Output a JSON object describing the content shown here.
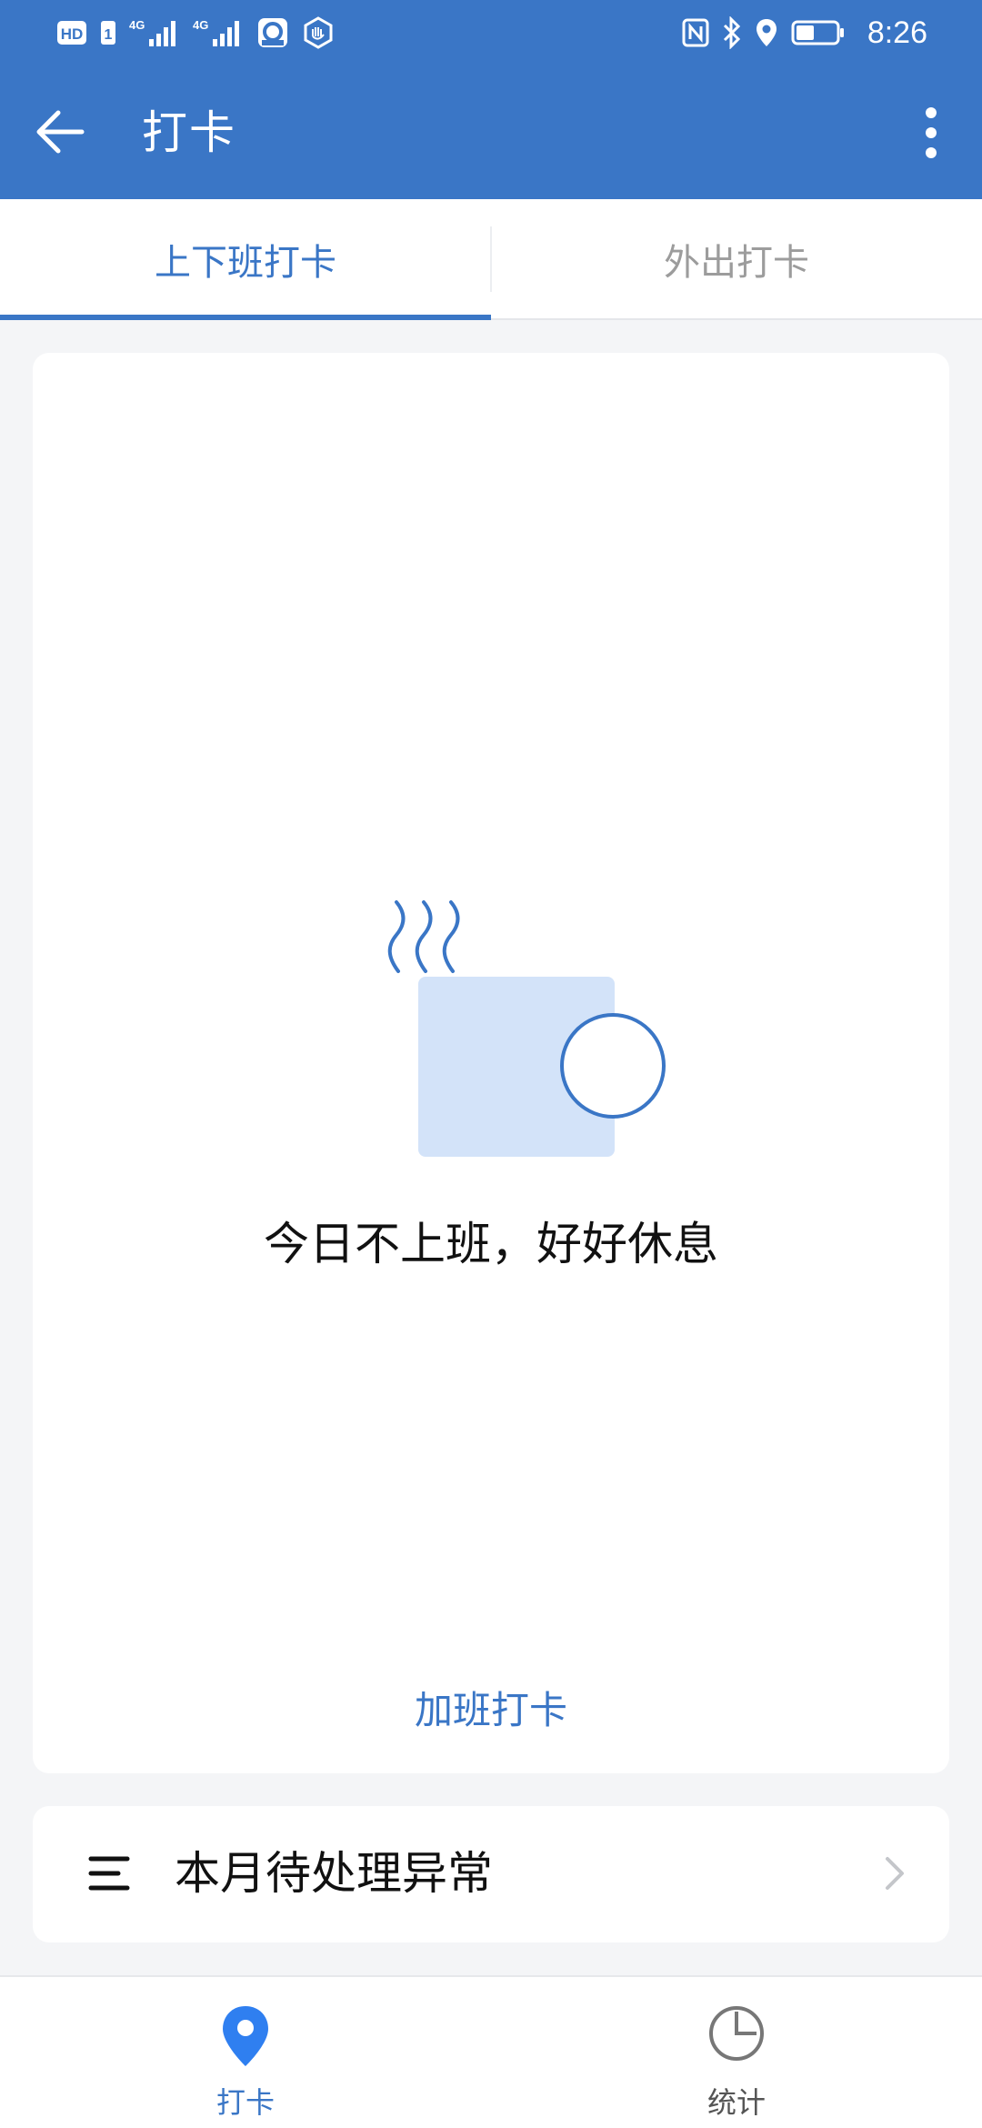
{
  "status_bar": {
    "time": "8:26",
    "left_icons": [
      "hd-icon",
      "sim-1-icon",
      "signal-4g-icon",
      "signal-4g-icon",
      "app-notification-icon",
      "app-notification-icon"
    ],
    "right_icons": [
      "nfc-icon",
      "bluetooth-icon",
      "location-icon",
      "battery-icon"
    ],
    "hd_label": "HD",
    "sim_label": "1",
    "net_label_1": "4G",
    "net_label_2": "4G"
  },
  "app_bar": {
    "title": "打卡",
    "back_icon": "arrow-left-icon",
    "more_icon": "more-vertical-icon"
  },
  "tabs": [
    {
      "label": "上下班打卡",
      "active": true
    },
    {
      "label": "外出打卡",
      "active": false
    }
  ],
  "main": {
    "rest_message": "今日不上班，好好休息",
    "overtime_button": "加班打卡",
    "illustration_icon": "coffee-cup-icon"
  },
  "pending": {
    "label": "本月待处理异常",
    "icon": "list-icon",
    "chevron": "chevron-right-icon"
  },
  "bottom_nav": [
    {
      "label": "打卡",
      "icon": "location-pin-icon",
      "active": true
    },
    {
      "label": "统计",
      "icon": "pie-chart-icon",
      "active": false
    }
  ],
  "colors": {
    "primary": "#3a76c6",
    "background": "#f4f5f7",
    "cup_fill": "#d3e3f9"
  }
}
